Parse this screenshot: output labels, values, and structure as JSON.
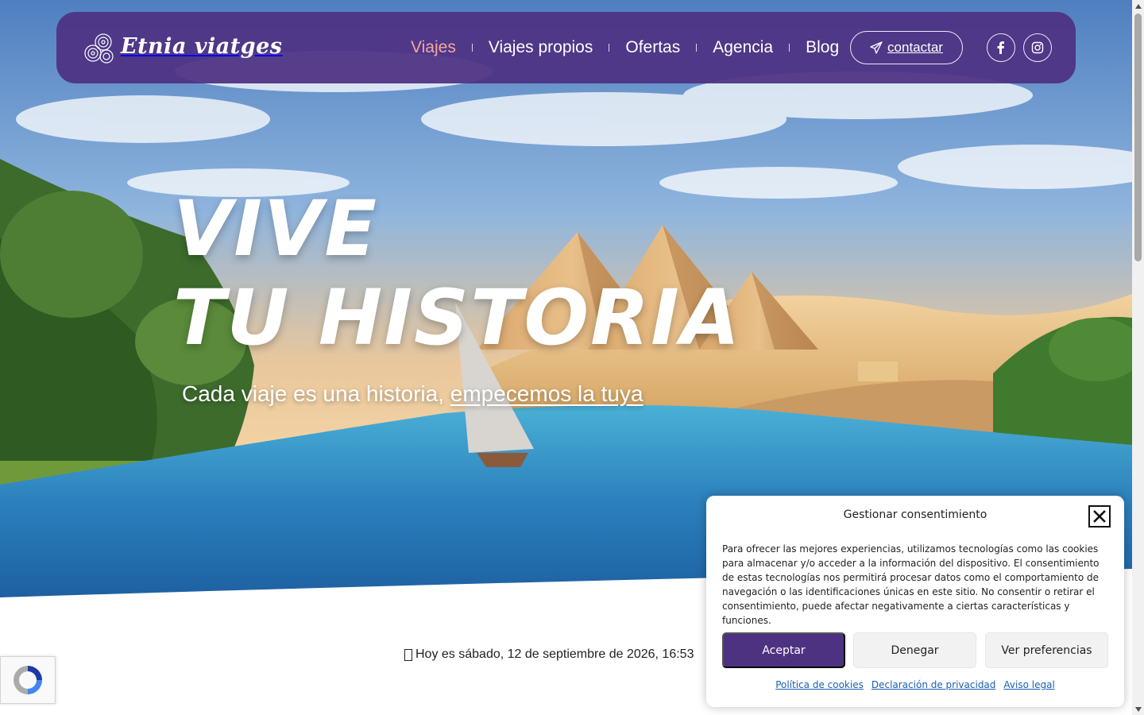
{
  "brand": {
    "name": "Etnia viatges",
    "primary_color": "#4e3282",
    "accent_color": "#f7a6a0"
  },
  "header": {
    "nav": [
      {
        "label": "Viajes",
        "active": true
      },
      {
        "label": "Viajes propios",
        "active": false
      },
      {
        "label": "Ofertas",
        "active": false
      },
      {
        "label": "Agencia",
        "active": false
      },
      {
        "label": "Blog",
        "active": false
      }
    ],
    "contact_label": "contactar",
    "contact_icon": "paper-plane-icon",
    "social": [
      {
        "icon": "facebook-icon"
      },
      {
        "icon": "instagram-icon"
      }
    ]
  },
  "hero": {
    "title_line1": "VIVE",
    "title_line2": "TU HISTORIA",
    "subtitle_text": "Cada viaje es una historia, ",
    "subtitle_link": "empecemos la tuya"
  },
  "date_line": "Hoy es sábado, 12 de septiembre de 2026, 16:53",
  "cookie": {
    "title": "Gestionar consentimiento",
    "body": "Para ofrecer las mejores experiencias, utilizamos tecnologías como las cookies para almacenar y/o acceder a la información del dispositivo. El consentimiento de estas tecnologías nos permitirá procesar datos como el comportamiento de navegación o las identificaciones únicas en este sitio. No consentir o retirar el consentimiento, puede afectar negativamente a ciertas características y funciones.",
    "accept_label": "Aceptar",
    "deny_label": "Denegar",
    "prefs_label": "Ver preferencias",
    "links": [
      "Política de cookies",
      "Declaración de privacidad",
      "Aviso legal"
    ]
  }
}
